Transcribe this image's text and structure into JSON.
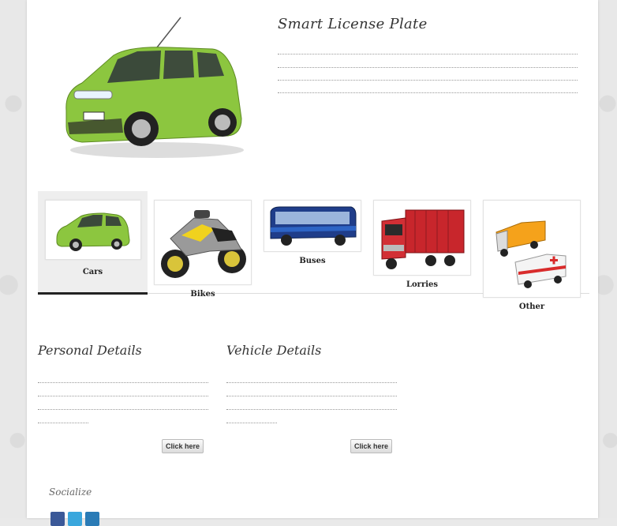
{
  "header": {
    "title": "Smart License Plate"
  },
  "tabs": [
    {
      "label": "Cars",
      "icon": "car-icon",
      "active": true
    },
    {
      "label": "Bikes",
      "icon": "motorbike-icon",
      "active": false
    },
    {
      "label": "Buses",
      "icon": "bus-icon",
      "active": false
    },
    {
      "label": "Lorries",
      "icon": "lorry-icon",
      "active": false
    },
    {
      "label": "Other",
      "icon": "van-ambulance-icon",
      "active": false
    }
  ],
  "sections": {
    "personal": {
      "title": "Personal Details",
      "button": "Click here"
    },
    "vehicle": {
      "title": "Vehicle Details",
      "button": "Click here"
    }
  },
  "footer": {
    "socialize": "Socialize",
    "social_icons": [
      "facebook-icon",
      "twitter-icon",
      "linkedin-icon"
    ]
  },
  "colors": {
    "car_green": "#8cc63f",
    "active_tab_bar": "#222222",
    "bus_blue": "#1f3d8a",
    "lorry_red": "#c8262c",
    "van_orange": "#f5a21b"
  }
}
